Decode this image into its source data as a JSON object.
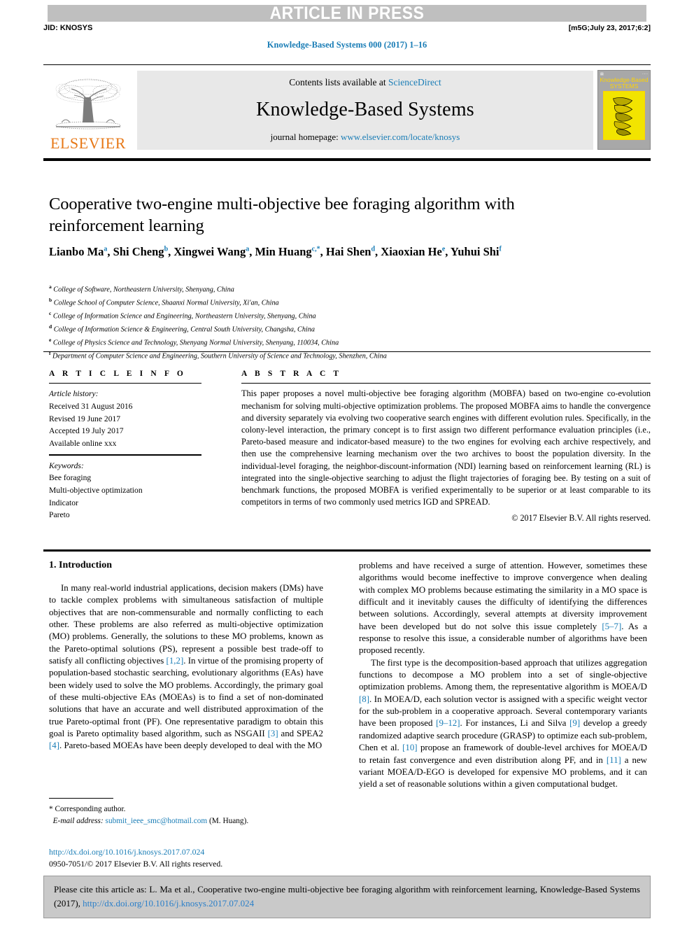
{
  "banner": {
    "article_in_press": "ARTICLE IN PRESS"
  },
  "header": {
    "jid": "JID: KNOSYS",
    "stamp": "[m5G;July 23, 2017;6:2]",
    "journal_ref": "Knowledge-Based Systems 000 (2017) 1–16"
  },
  "masthead": {
    "publisher": "ELSEVIER",
    "contents_prefix": "Contents lists available at ",
    "contents_link": "ScienceDirect",
    "journal_title": "Knowledge-Based Systems",
    "homepage_prefix": "journal homepage: ",
    "homepage_link": "www.elsevier.com/locate/knosys",
    "cover": {
      "line1": "Knowledge-Based",
      "line2": "SYSTEMS"
    }
  },
  "article": {
    "title": "Cooperative two-engine multi-objective bee foraging algorithm with reinforcement learning",
    "authors_html": "Lianbo Ma<sup>a</sup>, Shi Cheng<sup>b</sup>, Xingwei Wang<sup>a</sup>, Min Huang<sup>c,*</sup>, Hai Shen<sup>d</sup>, Xiaoxian He<sup>e</sup>, Yuhui Shi<sup>f</sup>",
    "affiliations": [
      {
        "mark": "a",
        "text": "College of Software, Northeastern University, Shenyang, China"
      },
      {
        "mark": "b",
        "text": "College School of Computer Science, Shaanxi Normal University, Xi'an, China"
      },
      {
        "mark": "c",
        "text": "College of Information Science and Engineering, Northeastern University, Shenyang, China"
      },
      {
        "mark": "d",
        "text": "College of Information Science & Engineering, Central South University, Changsha, China"
      },
      {
        "mark": "e",
        "text": "College of Physics Science and Technology, Shenyang Normal University, Shenyang, 110034, China"
      },
      {
        "mark": "f",
        "text": "Department of Computer Science and Engineering, Southern University of Science and Technology, Shenzhen, China"
      }
    ]
  },
  "article_info": {
    "label": "A R T I C L E   I N F O",
    "history_label": "Article history:",
    "history": [
      "Received 31 August 2016",
      "Revised 19 June 2017",
      "Accepted 19 July 2017",
      "Available online xxx"
    ],
    "keywords_label": "Keywords:",
    "keywords": [
      "Bee foraging",
      "Multi-objective optimization",
      "Indicator",
      "Pareto"
    ]
  },
  "abstract": {
    "label": "A B S T R A C T",
    "text": "This paper proposes a novel multi-objective bee foraging algorithm (MOBFA) based on two-engine co-evolution mechanism for solving multi-objective optimization problems. The proposed MOBFA aims to handle the convergence and diversity separately via evolving two cooperative search engines with different evolution rules. Specifically, in the colony-level interaction, the primary concept is to first assign two different performance evaluation principles (i.e., Pareto-based measure and indicator-based measure) to the two engines for evolving each archive respectively, and then use the comprehensive learning mechanism over the two archives to boost the population diversity. In the individual-level foraging, the neighbor-discount-information (NDI) learning based on reinforcement learning (RL) is integrated into the single-objective searching to adjust the flight trajectories of foraging bee. By testing on a suit of benchmark functions, the proposed MOBFA is verified experimentally to be superior or at least comparable to its competitors in terms of two commonly used metrics IGD and SPREAD.",
    "copyright": "© 2017 Elsevier B.V. All rights reserved."
  },
  "body": {
    "section_heading": "1. Introduction",
    "left_paragraph_1_html": "In many real-world industrial applications, decision makers (DMs) have to tackle complex problems with simultaneous satisfaction of multiple objectives that are non-commensurable and normally conflicting to each other. These problems are also referred as multi-objective optimization (MO) problems. Generally, the solutions to these MO problems, known as the Pareto-optimal solutions (PS), represent a possible best trade-off to satisfy all conflicting objectives <span class=\"ref\">[1,2]</span>. In virtue of the promising property of population-based stochastic searching, evolutionary algorithms (EAs) have been widely used to solve the MO problems. Accordingly, the primary goal of these multi-objective EAs (MOEAs) is to find a set of non-dominated solutions that have an accurate and well distributed approximation of the true Pareto-optimal front (PF). One representative paradigm to obtain this goal is Pareto optimality based algorithm, such as NSGAII <span class=\"ref\">[3]</span> and SPEA2 <span class=\"ref\">[4]</span>. Pareto-based MOEAs have been deeply developed to deal with the MO",
    "right_paragraph_1_html": "problems and have received a surge of attention. However, sometimes these algorithms would become ineffective to improve convergence when dealing with complex MO problems because estimating the similarity in a MO space is difficult and it inevitably causes the difficulty of identifying the differences between solutions. Accordingly, several attempts at diversity improvement have been developed but do not solve this issue completely <span class=\"ref\">[5–7]</span>. As a response to resolve this issue, a considerable number of algorithms have been proposed recently.",
    "right_paragraph_2_html": "The first type is the decomposition-based approach that utilizes aggregation functions to decompose a MO problem into a set of single-objective optimization problems. Among them, the representative algorithm is MOEA/D <span class=\"ref\">[8]</span>. In MOEA/D, each solution vector is assigned with a specific weight vector for the sub-problem in a cooperative approach. Several contemporary variants have been proposed <span class=\"ref\">[9–12]</span>. For instances, Li and Silva <span class=\"ref\">[9]</span> develop a greedy randomized adaptive search procedure (GRASP) to optimize each sub-problem, Chen et al. <span class=\"ref\">[10]</span> propose an framework of double-level archives for MOEA/D to retain fast convergence and even distribution along PF, and in <span class=\"ref\">[11]</span> a new variant MOEA/D-EGO is developed for expensive MO problems, and it can yield a set of reasonable solutions within a given computational budget."
  },
  "footnote": {
    "corresponding": "* Corresponding author.",
    "email_label": "E-mail address:",
    "email": "submit_ieee_smc@hotmail.com",
    "email_owner": "(M. Huang).",
    "doi": "http://dx.doi.org/10.1016/j.knosys.2017.07.024",
    "issn_line": "0950-7051/© 2017 Elsevier B.V. All rights reserved."
  },
  "cite_box": {
    "text_before": "Please cite this article as: L. Ma et al., Cooperative two-engine multi-objective bee foraging algorithm with reinforcement learning, Knowledge-Based Systems (2017), ",
    "doi": "http://dx.doi.org/10.1016/j.knosys.2017.07.024"
  },
  "colors": {
    "link": "#1a7db6",
    "banner_bg": "#bfbfbf",
    "elsevier_orange": "#e77817",
    "cover_yellow": "#f2e400",
    "cite_bg": "#c9c9c9"
  }
}
